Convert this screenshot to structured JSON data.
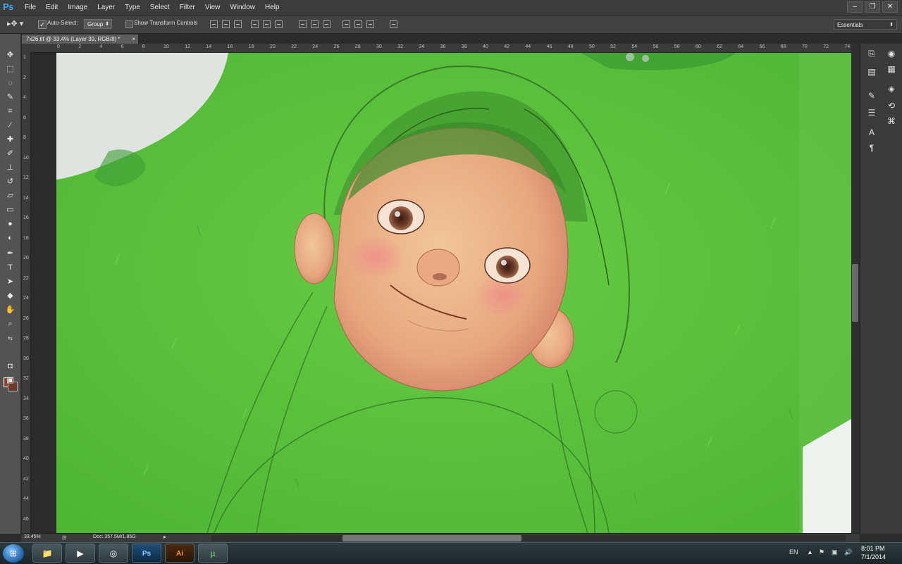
{
  "app": {
    "logo": "Ps"
  },
  "menu": [
    "File",
    "Edit",
    "Image",
    "Layer",
    "Type",
    "Select",
    "Filter",
    "View",
    "Window",
    "Help"
  ],
  "window_controls": [
    "–",
    "❐",
    "✕"
  ],
  "options": {
    "auto_select_label": "Auto-Select:",
    "auto_select_checked": true,
    "target_value": "Group",
    "show_transform_label": "Show Transform Controls",
    "show_transform_checked": false,
    "workspace": "Essentials"
  },
  "document": {
    "tab_title": "7x26.tif @ 33.4% (Layer 39, RGB/8) *"
  },
  "ruler": {
    "top_labels": [
      "0",
      "2",
      "4",
      "6",
      "8",
      "10",
      "12",
      "14",
      "16",
      "18",
      "20",
      "22",
      "24",
      "26",
      "28",
      "30",
      "32",
      "34",
      "36",
      "38",
      "40",
      "42",
      "44",
      "46",
      "48",
      "50",
      "52",
      "54",
      "56",
      "58",
      "60",
      "62",
      "64",
      "66",
      "68",
      "70",
      "72",
      "74"
    ],
    "left_labels": [
      "1",
      "2",
      "4",
      "6",
      "8",
      "10",
      "12",
      "14",
      "16",
      "18",
      "20",
      "22",
      "24",
      "26",
      "28",
      "30",
      "32",
      "34",
      "36",
      "38",
      "40",
      "42",
      "44",
      "46"
    ]
  },
  "status": {
    "zoom": "33.45%",
    "doc_size": "Doc: 357.5M/1.85G"
  },
  "taskbar": {
    "lang": "EN",
    "time": "8:01 PM",
    "date": "7/1/2014"
  },
  "colors": {
    "foreground": "#8a4a32",
    "background": "#6b3a28",
    "canvas_grass": "#5cc23e",
    "accent_ps": "#38a7f5"
  }
}
